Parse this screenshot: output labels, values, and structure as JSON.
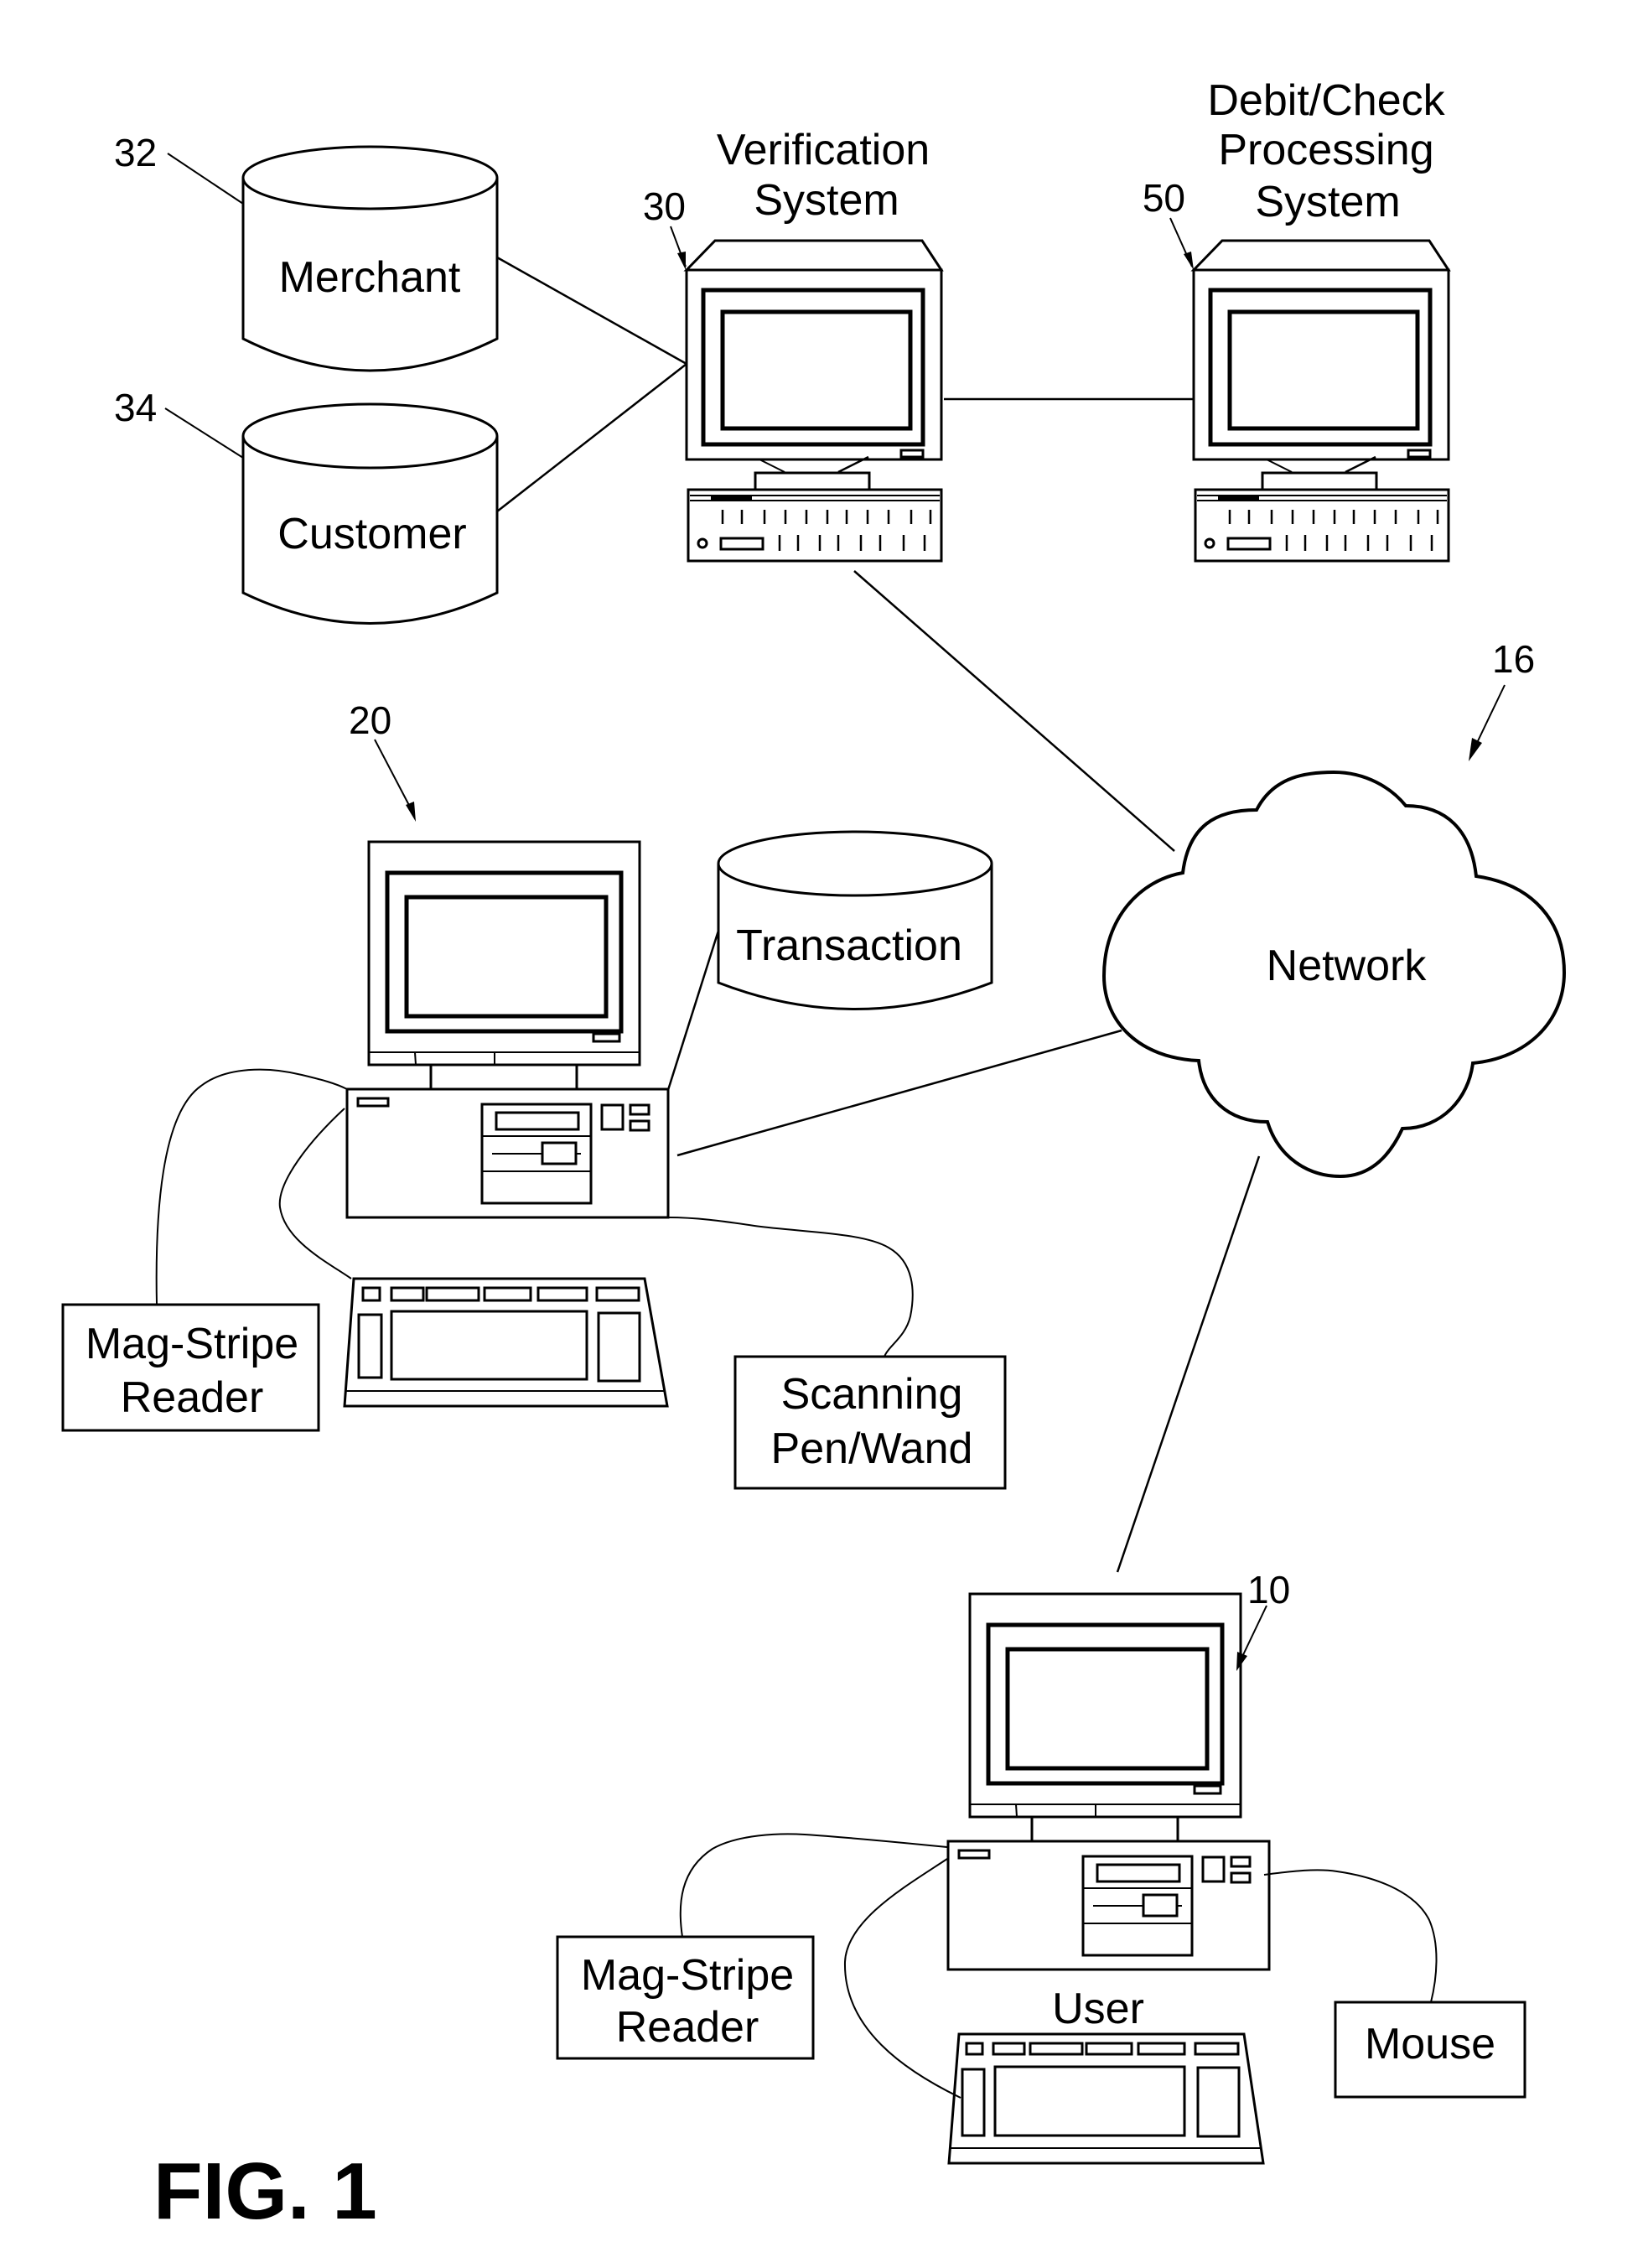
{
  "figure": {
    "title": "FIG. 1",
    "background": "#ffffff",
    "ink": "#000000"
  },
  "databases": {
    "merchant": {
      "label": "Merchant",
      "ref": "32"
    },
    "customer": {
      "label": "Customer",
      "ref": "34"
    },
    "transaction": {
      "label": "Transaction"
    }
  },
  "verification_system": {
    "title_lines": [
      "Verification",
      "System"
    ],
    "ref": "30"
  },
  "debit_check_system": {
    "title_lines": [
      "Debit/Check",
      "Processing",
      "System"
    ],
    "ref": "50"
  },
  "network": {
    "label": "Network",
    "ref": "16"
  },
  "merchant_terminal": {
    "ref": "20",
    "peripherals": {
      "mag_stripe": [
        "Mag-Stripe",
        "Reader"
      ],
      "scanner": [
        "Scanning",
        "Pen/Wand"
      ]
    }
  },
  "user_terminal": {
    "ref": "10",
    "label": "User",
    "peripherals": {
      "mag_stripe": [
        "Mag-Stripe",
        "Reader"
      ],
      "mouse": "Mouse"
    }
  },
  "connections": [
    {
      "from": "merchant-database",
      "to": "verification-system"
    },
    {
      "from": "customer-database",
      "to": "verification-system"
    },
    {
      "from": "verification-system",
      "to": "debit-check-processing-system"
    },
    {
      "from": "verification-system",
      "to": "network"
    },
    {
      "from": "merchant-terminal",
      "to": "network"
    },
    {
      "from": "merchant-terminal",
      "to": "transaction-database"
    },
    {
      "from": "network",
      "to": "user-terminal"
    },
    {
      "from": "merchant-terminal",
      "to": "mag-stripe-reader"
    },
    {
      "from": "merchant-terminal",
      "to": "keyboard"
    },
    {
      "from": "merchant-terminal",
      "to": "scanning-pen-wand"
    },
    {
      "from": "user-terminal",
      "to": "mag-stripe-reader"
    },
    {
      "from": "user-terminal",
      "to": "keyboard"
    },
    {
      "from": "user-terminal",
      "to": "mouse"
    }
  ]
}
